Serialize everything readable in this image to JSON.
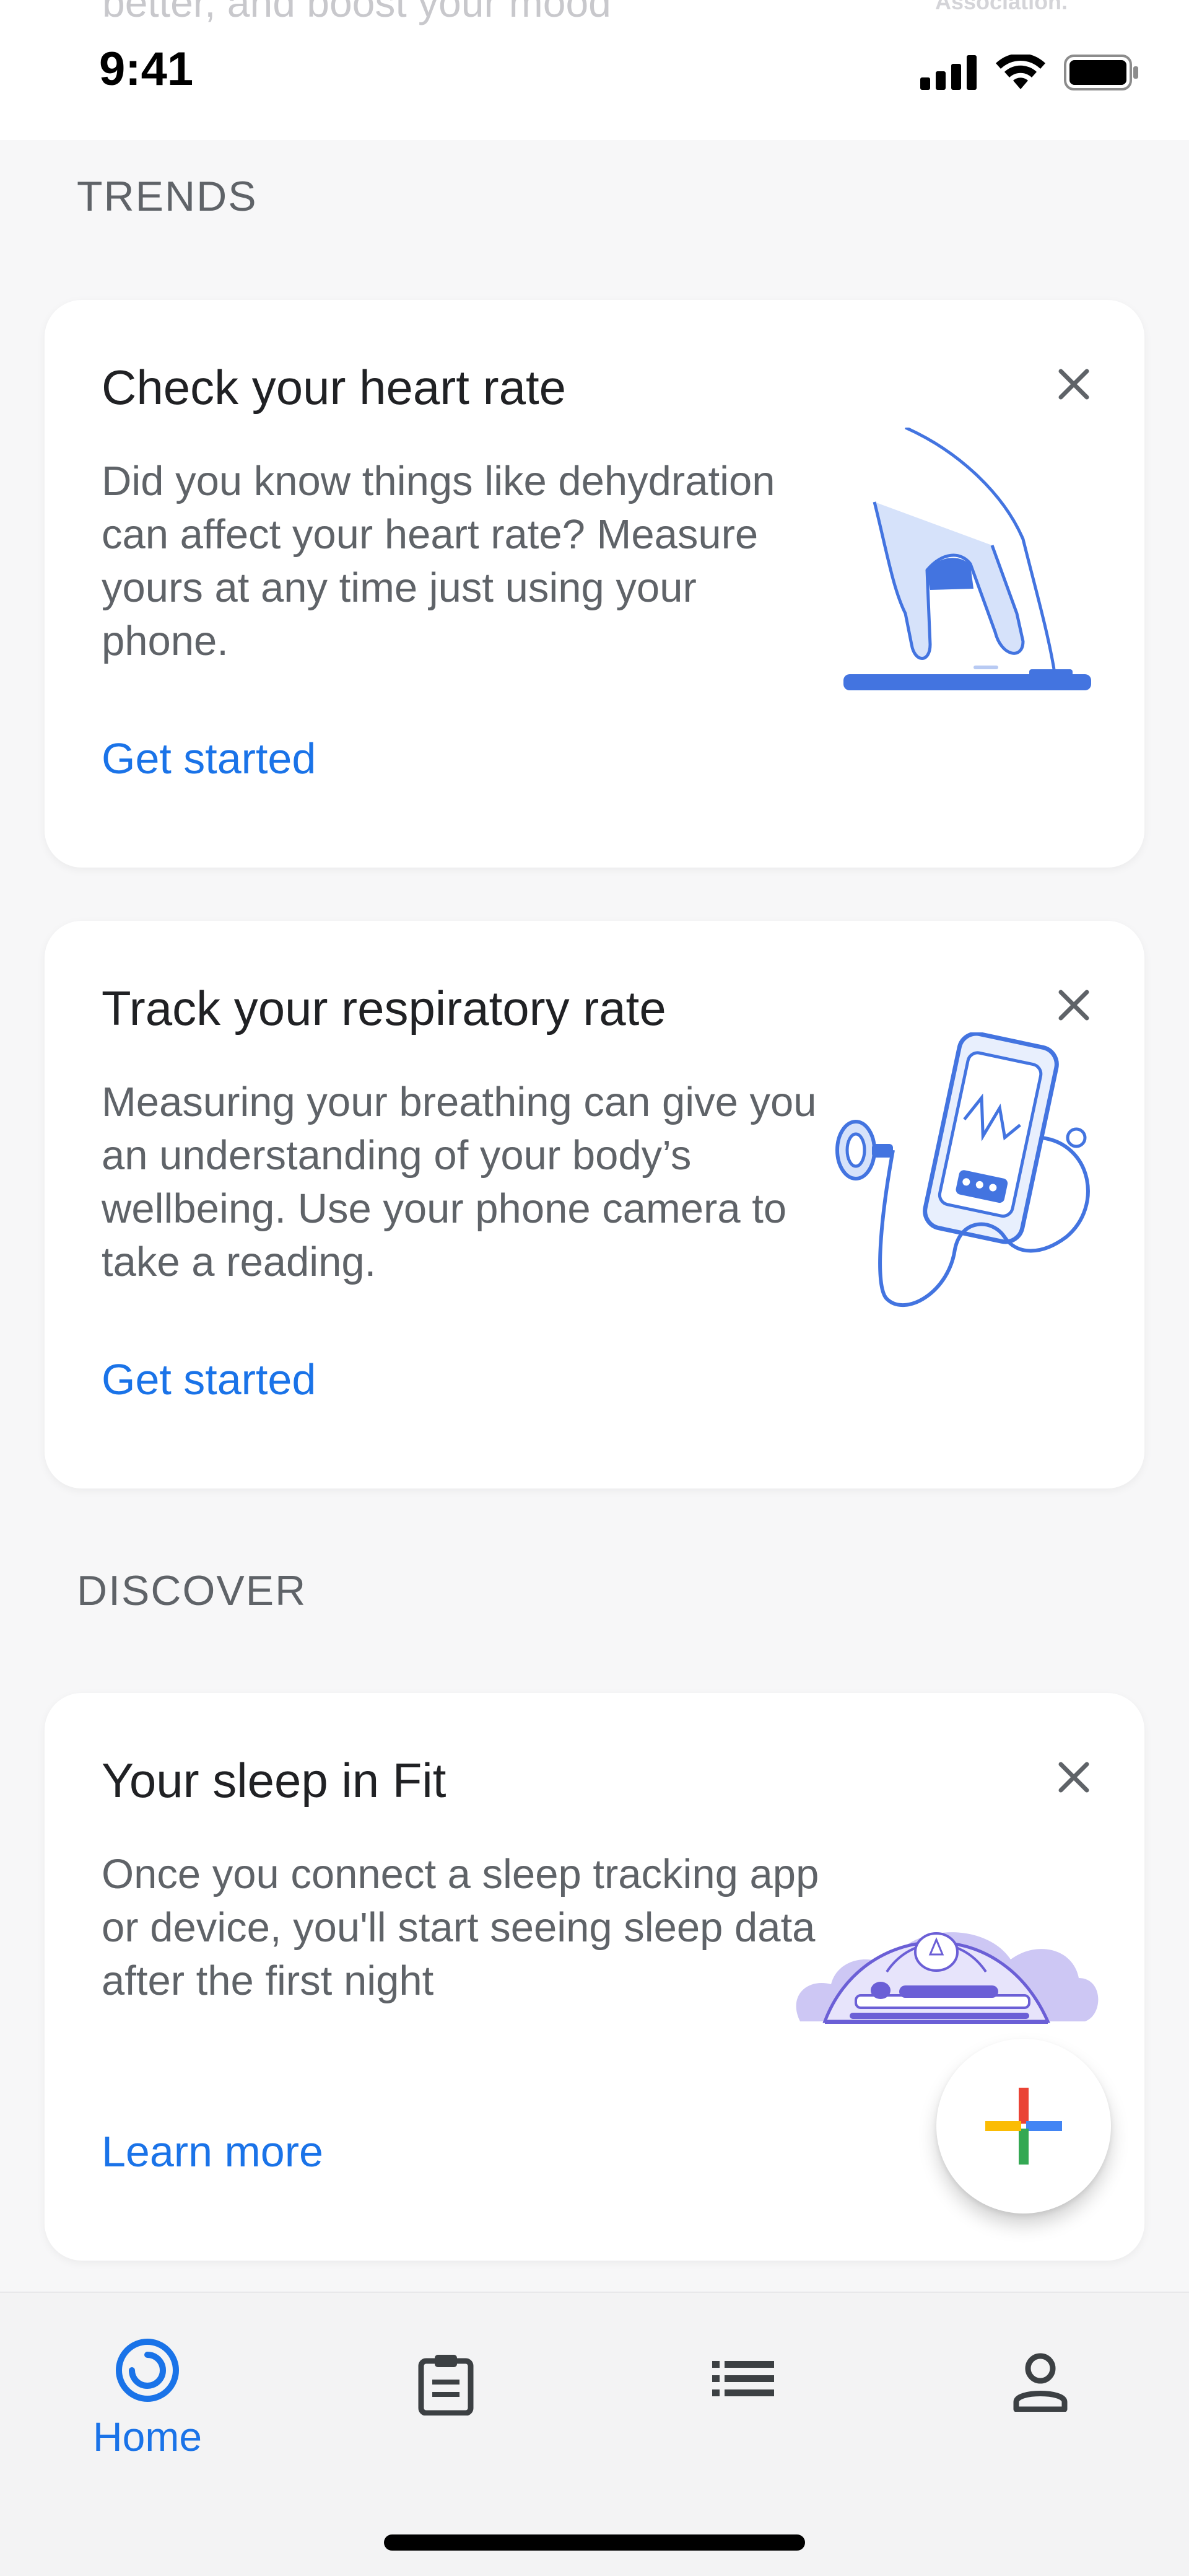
{
  "status_bar": {
    "time": "9:41",
    "peek_text": "better, and boost your mood",
    "peek_logo": "Association."
  },
  "sections": {
    "trends": "TRENDS",
    "discover": "DISCOVER"
  },
  "cards": {
    "heart_rate": {
      "title": "Check your heart rate",
      "body": "Did you know things like dehydration can affect your heart rate? Measure yours at any time just using your phone.",
      "link": "Get started",
      "illustration": "finger-on-phone-illustration"
    },
    "respiratory": {
      "title": "Track your respiratory rate",
      "body": "Measuring your breathing can give you an understanding of your body’s wellbeing. Use your phone camera to take a reading.",
      "link": "Get started",
      "illustration": "phone-stethoscope-illustration"
    },
    "sleep": {
      "title": "Your sleep in Fit",
      "body": "Once you connect a sleep tracking app or device, you'll start seeing sleep data after the first night",
      "link": "Learn more",
      "illustration": "tent-sleeping-illustration"
    }
  },
  "fab": {
    "icon": "plus-icon"
  },
  "bottom_nav": {
    "items": [
      {
        "label": "Home",
        "icon": "home-ring-icon",
        "active": true
      },
      {
        "label": "",
        "icon": "journal-icon",
        "active": false
      },
      {
        "label": "",
        "icon": "browse-list-icon",
        "active": false
      },
      {
        "label": "",
        "icon": "profile-icon",
        "active": false
      }
    ]
  },
  "colors": {
    "accent": "#1a73e8",
    "illustration_blue": "#4374e0",
    "background": "#f7f7f8",
    "card": "#ffffff"
  }
}
